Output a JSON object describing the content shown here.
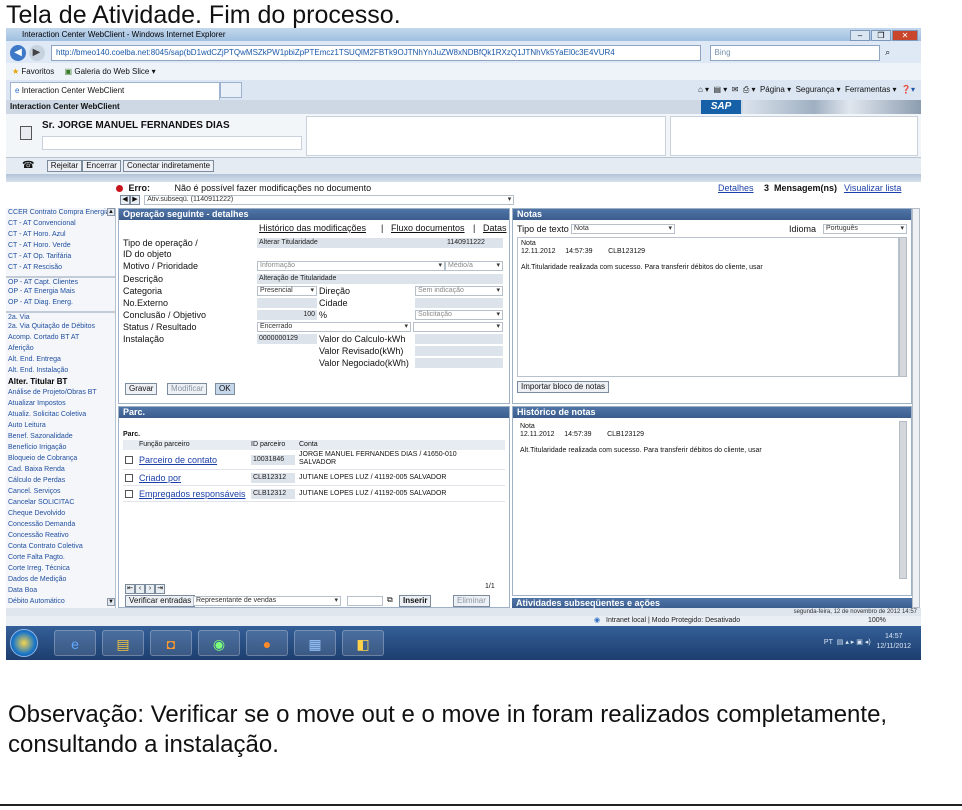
{
  "doc": {
    "title": "Tela de Atividade. Fim do processo.",
    "note": "Observação: Verificar se o move out e o move in foram realizados completamente, consultando a instalação."
  },
  "browser": {
    "title": "Interaction Center WebClient - Windows Internet Explorer",
    "url": "http://bmeo140.coelba.net:8045/sap(bD1wdCZjPTQwMSZkPW1pbiZpPTEmcz1TSUQlM2FBTk9OJTNhYnJuZW8xNDBfQk1RXzQ1JTNhVk5YaEl0c3E4VUR4",
    "search_placeholder": "Bing",
    "fav_label": "Favoritos",
    "fav_item": "Galeria do Web Slice ▾",
    "tab_label": "Interaction Center WebClient",
    "cmd_pagina": "Página ▾",
    "cmd_seguranca": "Segurança ▾",
    "cmd_ferramentas": "Ferramentas ▾"
  },
  "app": {
    "title": "Interaction Center WebClient",
    "sap_logo": "SAP"
  },
  "customer": {
    "name": "Sr. JORGE MANUEL FERNANDES DIAS"
  },
  "toolbar": {
    "rejeitar": "Rejeitar",
    "encerrar": "Encerrar",
    "conectar": "Conectar indiretamente"
  },
  "error": {
    "label": "Erro:",
    "message": "Não é possível fazer modificações no documento",
    "detalhes": "Detalhes",
    "count": "3",
    "mensagens": "Mensagem(ns)",
    "visualizar": "Visualizar lista"
  },
  "pager": {
    "value": "Ativ.subseqü. (1140911222)"
  },
  "sidebar": {
    "items": [
      "CCER Contrato Compra Energia",
      "CT - AT Convencional",
      "CT - AT Horo. Azul",
      "CT - AT Horo. Verde",
      "CT - AT Op. Tarifária",
      "CT - AT Rescisão",
      "OP - AT Capt. Clientes",
      "OP - AT Energia Mais",
      "OP - AT Diag. Energ.",
      "2a. Via",
      "2a. Via Quitação de Débitos",
      "Acomp. Cortado BT AT",
      "Aferição",
      "Alt. End. Entrega",
      "Alt. End. Instalação",
      "Alter. Titular BT",
      "Análise de Projeto/Obras BT",
      "Atualizar Impostos",
      "Atualiz. Solicitac Coletiva",
      "Auto Leitura",
      "Benef. Sazonalidade",
      "Benefício Irrigação",
      "Bloqueio de Cobrança",
      "Cad. Baixa Renda",
      "Cálculo de Perdas",
      "Cancel. Serviços",
      "Cancelar SOLICITAC",
      "Cheque Devolvido",
      "Concessão Demanda",
      "Concessão Reativo",
      "Conta Contrato Coletiva",
      "Corte Falta Pagto.",
      "Corte Irreg. Técnica",
      "Dados de Medição",
      "Data Boa",
      "Débito Automático"
    ]
  },
  "operacao": {
    "header": "Operação seguinte - detalhes",
    "link_historico": "Histórico das modificações",
    "link_fluxo": "Fluxo documentos",
    "link_datas": "Datas",
    "lbl_tipo": "Tipo de operação /",
    "lbl_id": "ID do objeto",
    "val_tipo": "Alterar Titularidade",
    "val_id": "1140911222",
    "lbl_motivo": "Motivo / Prioridade",
    "val_motivo": "Informação",
    "val_prioridade": "Médio/a",
    "lbl_descricao": "Descrição",
    "val_descricao": "Alteração de Titularidade",
    "lbl_categoria": "Categoria",
    "val_categoria": "Presencial",
    "lbl_direcao": "Direção",
    "val_direcao": "Sem indicação",
    "lbl_externo": "No.Externo",
    "lbl_cidade": "Cidade",
    "lbl_conclusao": "Conclusão / Objetivo",
    "val_conclusao": "100",
    "pct": "%",
    "val_objetivo": "Solicitação",
    "lbl_status": "Status / Resultado",
    "val_status": "Encerrado",
    "lbl_instalacao": "Instalação",
    "val_instalacao": "0000000129",
    "lbl_calculo": "Valor do Calculo-kWh",
    "lbl_revisado": "Valor Revisado(kWh)",
    "lbl_negociado": "Valor Negociado(kWh)",
    "btn_gravar": "Gravar",
    "btn_modificar": "Modificar",
    "btn_ok": "OK"
  },
  "parc": {
    "header": "Parc.",
    "table_title": "Parc.",
    "col_funcao": "Função parceiro",
    "col_id": "ID parceiro",
    "col_conta": "Conta",
    "rows": [
      {
        "funcao": "Parceiro de contato",
        "id": "10031846",
        "conta": "JORGE MANUEL FERNANDES DIAS / 41650-010 SALVADOR"
      },
      {
        "funcao": "Criado por",
        "id": "CLB12312",
        "conta": "JUTIANE LOPES LUZ / 41192-005 SALVADOR"
      },
      {
        "funcao": "Empregados responsáveis",
        "id": "CLB12312",
        "conta": "JUTIANE LOPES LUZ / 41192-005 SALVADOR"
      }
    ],
    "page": "1/1",
    "btn_verificar": "Verificar entradas",
    "select_val": "Representante de vendas",
    "btn_inserir": "Inserir",
    "btn_eliminar": "Eliminar"
  },
  "notas": {
    "header": "Notas",
    "lbl_tipo": "Tipo de texto",
    "val_tipo": "Nota",
    "lbl_idioma": "Idioma",
    "val_idioma": "Português",
    "note_label": "Nota",
    "note_date": "12.11.2012",
    "note_time": "14:57:39",
    "note_user": "CLB123129",
    "note_text": "Alt.Titularidade realizada com sucesso. Para transferir débitos do cliente, usar",
    "btn_importar": "Importar bloco de notas"
  },
  "historico": {
    "header": "Histórico de notas",
    "note_label": "Nota",
    "note_date": "12.11.2012",
    "note_time": "14:57:39",
    "note_user": "CLB123129",
    "note_text": "Alt.Titularidade realizada com sucesso. Para transferir débitos do cliente, usar"
  },
  "atividades": {
    "header": "Atividades subseqüentes e ações"
  },
  "status": {
    "datetime": "segunda-feira, 12 de novembro de 2012 14:57",
    "zone": "Intranet local | Modo Protegido: Desativado",
    "zoom": "100%"
  },
  "tray": {
    "lang": "PT",
    "time": "14:57",
    "date": "12/11/2012"
  }
}
